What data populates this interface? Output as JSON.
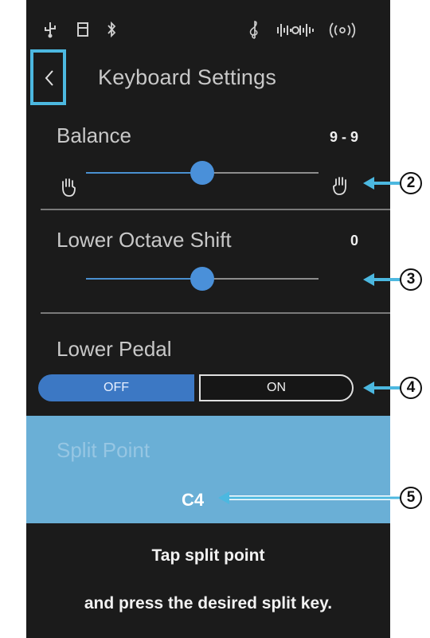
{
  "header": {
    "title": "Keyboard Settings",
    "back_icon": "chevron-left-icon"
  },
  "status_bar": {
    "icons": [
      "usb-icon",
      "usb-memory-icon",
      "bluetooth-icon",
      "treble-clef-icon",
      "audio-icon",
      "wireless-icon"
    ]
  },
  "balance": {
    "label": "Balance",
    "value": "9 - 9",
    "level": 0.5
  },
  "lower_octave_shift": {
    "label": "Lower Octave Shift",
    "value": "0",
    "level": 0.5
  },
  "lower_pedal": {
    "label": "Lower Pedal",
    "off_label": "OFF",
    "on_label": "ON",
    "selected": "OFF"
  },
  "split_point": {
    "label": "Split Point",
    "value": "C4"
  },
  "hint": {
    "line1": "Tap split point",
    "line2": "and press the desired split key."
  },
  "callouts": [
    "2",
    "3",
    "4",
    "5"
  ],
  "colors": {
    "accent": "#4a90d9",
    "highlight": "#4cb8e0",
    "panel": "#6aafd6",
    "background": "#1b1b1b"
  }
}
